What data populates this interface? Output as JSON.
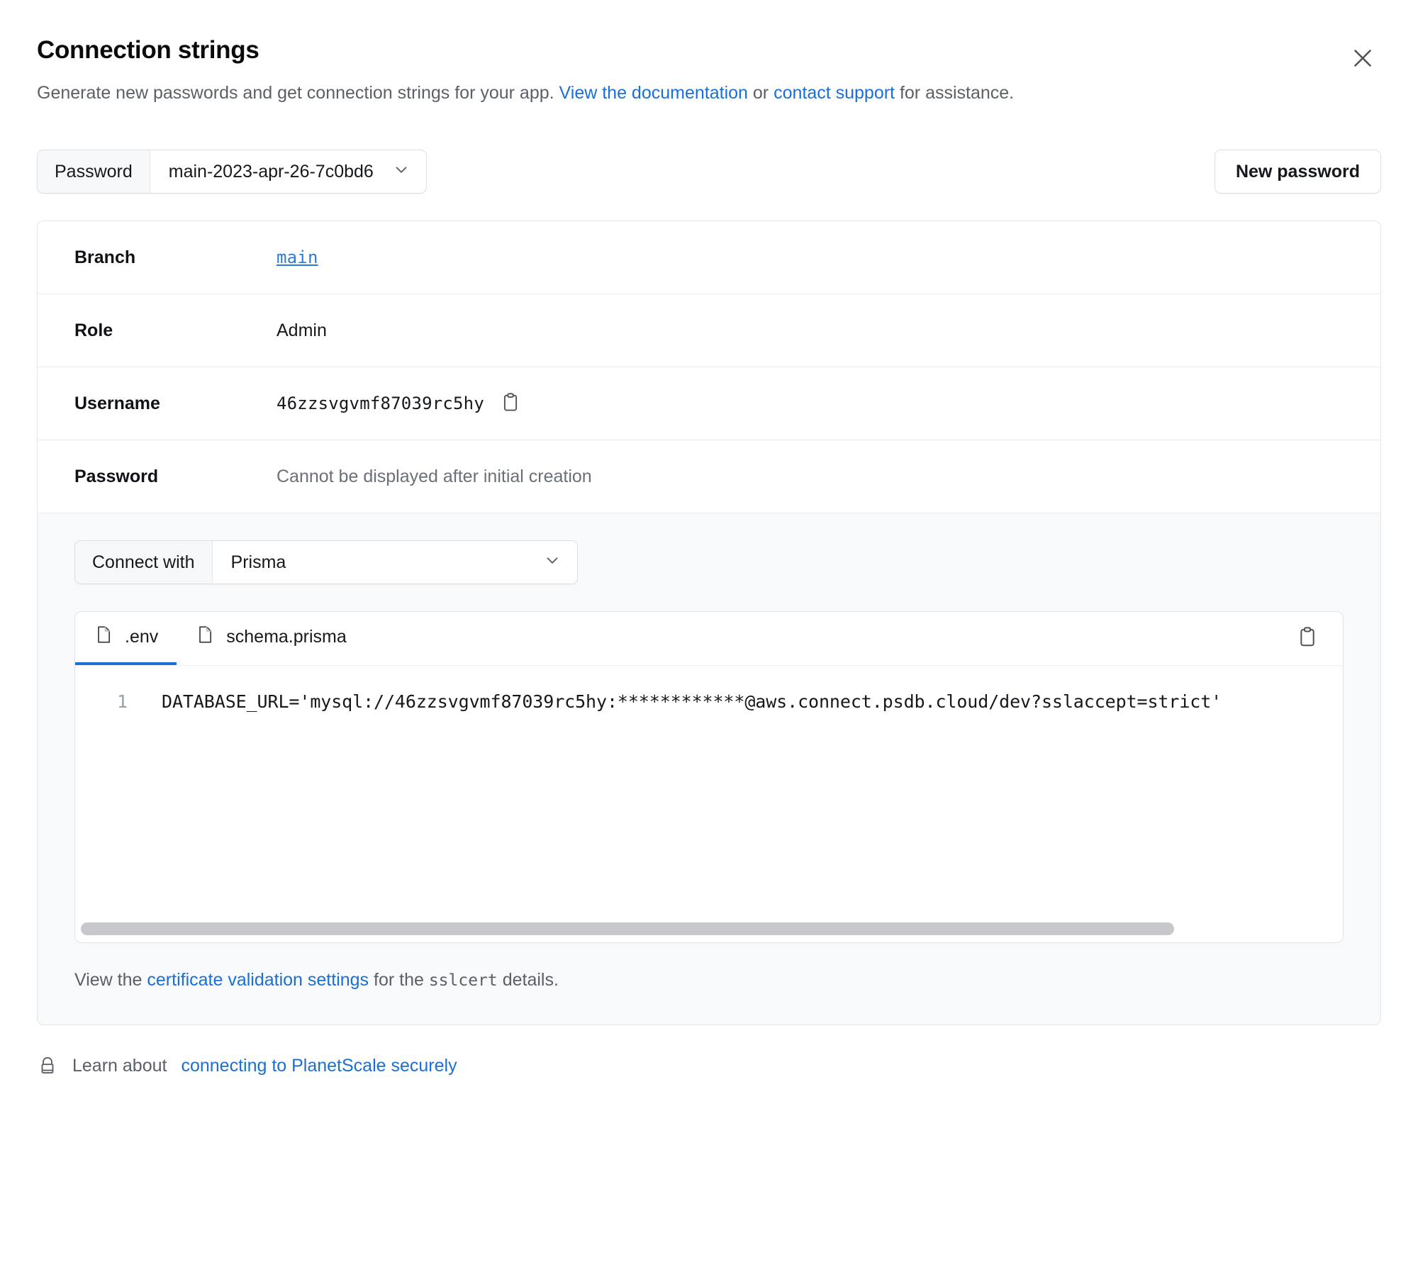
{
  "dialog": {
    "title": "Connection strings",
    "subtitle_part1": "Generate new passwords and get connection strings for your app. ",
    "subtitle_link1": "View the documentation",
    "subtitle_part2": " or ",
    "subtitle_link2": "contact support",
    "subtitle_part3": " for assistance.",
    "close_icon": "close-icon"
  },
  "password_row": {
    "label": "Password",
    "selected": "main-2023-apr-26-7c0bd6",
    "chevron_icon": "chevron-down-icon",
    "new_password_button": "New password"
  },
  "info": {
    "rows": [
      {
        "label": "Branch",
        "value": "main",
        "style": "mono-link"
      },
      {
        "label": "Role",
        "value": "Admin",
        "style": "plain"
      },
      {
        "label": "Username",
        "value": "46zzsvgvmf87039rc5hy",
        "style": "mono",
        "copy_icon": "clipboard-icon"
      },
      {
        "label": "Password",
        "value": "Cannot be displayed after initial creation",
        "style": "muted"
      }
    ]
  },
  "connect": {
    "label": "Connect with",
    "selected": "Prisma",
    "chevron_icon": "chevron-down-icon",
    "editor": {
      "tabs": [
        {
          "label": ".env",
          "icon": "file-icon",
          "active": true
        },
        {
          "label": "schema.prisma",
          "icon": "file-icon",
          "active": false
        }
      ],
      "copy_icon": "clipboard-icon",
      "line_number": "1",
      "code": "DATABASE_URL='mysql://46zzsvgvmf87039rc5hy:************@aws.connect.psdb.cloud/dev?sslaccept=strict'"
    },
    "cert_note_part1": "View the ",
    "cert_note_link": "certificate validation settings",
    "cert_note_part2": " for the ",
    "cert_note_mono": "sslcert",
    "cert_note_part3": " details."
  },
  "footer": {
    "lock_icon": "lock-icon",
    "text": "Learn about ",
    "link": "connecting to PlanetScale securely"
  },
  "colors": {
    "link": "#1b6fd4",
    "accent_tab": "#1b6fd4",
    "mono_link": "#2e7bd6",
    "text": "#15181c",
    "muted": "#5b6068",
    "panel_bg": "#f8f9fa",
    "border": "#e4e6e9"
  }
}
